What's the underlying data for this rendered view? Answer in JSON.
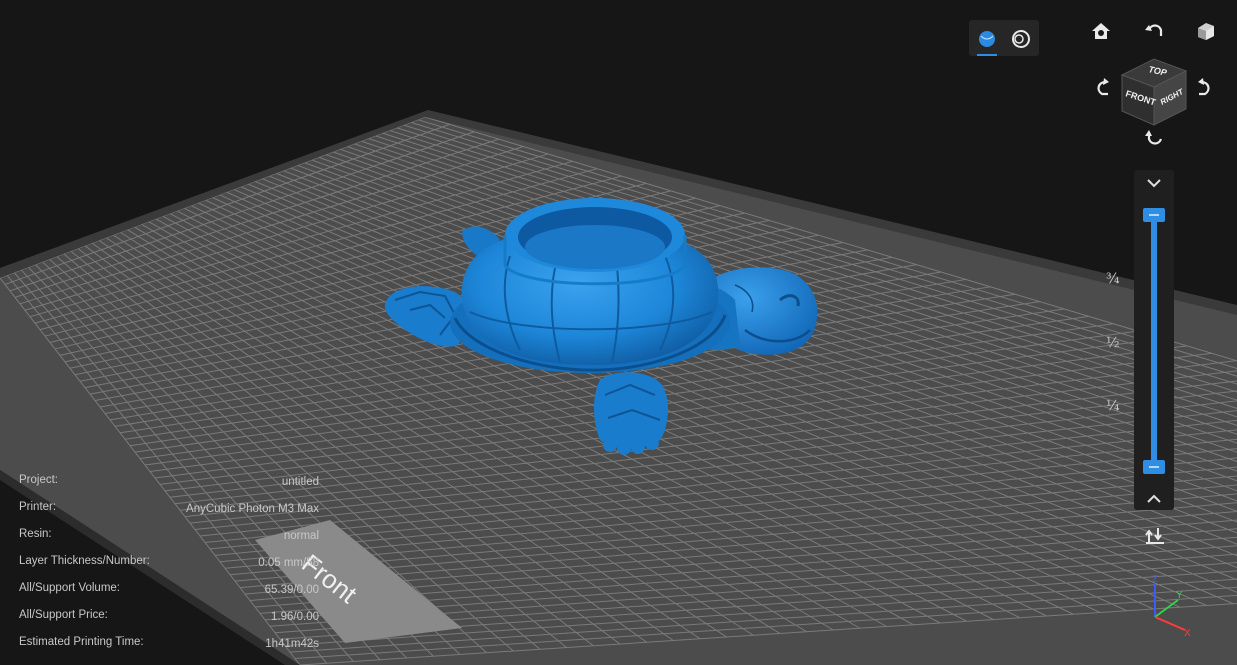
{
  "viewport": {
    "plate_label": "Front",
    "model_color": "#1d86d8",
    "plate_color": "#4f4f4f",
    "grid_color": "#8a8a8a",
    "background_color": "#161616"
  },
  "view_modes": [
    {
      "name": "solid-view-icon",
      "active": true
    },
    {
      "name": "xray-view-icon",
      "active": false
    }
  ],
  "view_cube": {
    "top": "TOP",
    "front": "FRONT",
    "right": "RIGHT"
  },
  "nav_buttons": [
    "home-view-icon",
    "rotate-up-icon",
    "iso-view-icon",
    "rotate-left-icon",
    "rotate-right-icon",
    "rotate-down-icon"
  ],
  "layer_slider": {
    "ticks": [
      "¾",
      "½",
      "¼"
    ],
    "top_value": 1.0,
    "bottom_value": 0.0,
    "accent_color": "#2f8de4"
  },
  "axis_gizmo": {
    "x": "X",
    "y": "Y",
    "z": "Z"
  },
  "info": {
    "rows": [
      {
        "label": "Project:",
        "value": "untitled"
      },
      {
        "label": "Printer:",
        "value": "AnyCubic Photon M3 Max"
      },
      {
        "label": "Resin:",
        "value": "normal"
      },
      {
        "label": "Layer Thickness/Number:",
        "value": "0.05 mm/58"
      },
      {
        "label": "All/Support Volume:",
        "value": "65.39/0.00"
      },
      {
        "label": "All/Support Price:",
        "value": "1.96/0.00"
      },
      {
        "label": "Estimated Printing Time:",
        "value": "1h41m42s"
      }
    ]
  }
}
